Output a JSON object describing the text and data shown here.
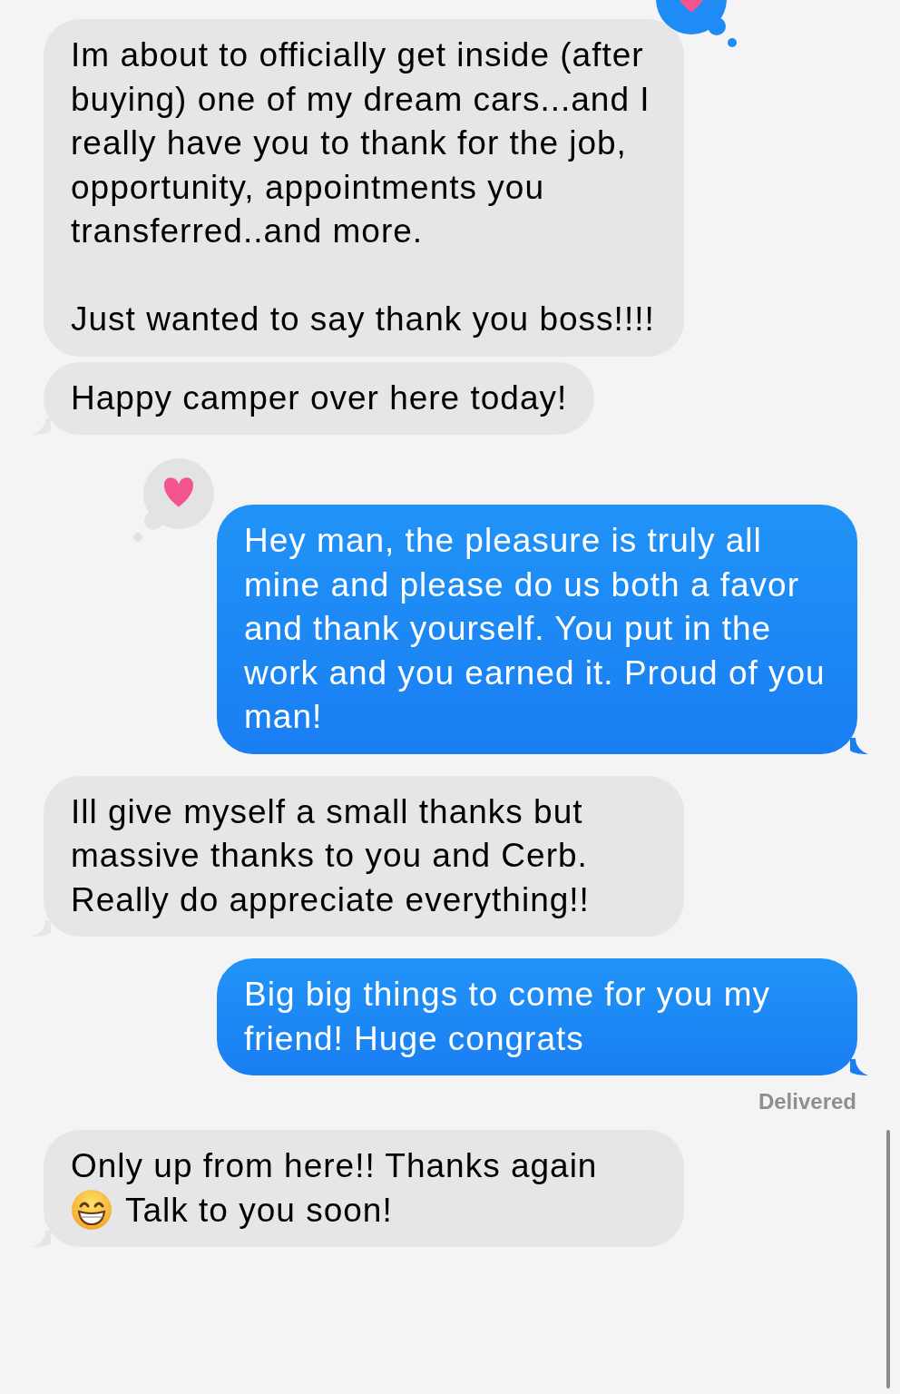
{
  "messages": [
    {
      "kind": "received",
      "parts": [
        {
          "kind": "text",
          "text": "Im about to officially get inside (after buying) one of my dream cars...and I really have you to thank for the job, opportunity, appointments you transferred..and more.\n\nJust wanted to say thank you boss!!!!"
        }
      ],
      "tail": false,
      "reaction": {
        "kind": "heart",
        "color": "#1f8bf5"
      }
    },
    {
      "kind": "received",
      "parts": [
        {
          "kind": "text",
          "text": "Happy camper over here today!"
        }
      ],
      "tail": true
    },
    {
      "kind": "sent",
      "parts": [
        {
          "kind": "text",
          "text": "Hey man, the pleasure is truly all mine and please do us both a favor and thank yourself. You put in the work and you earned it. Proud of you man!"
        }
      ],
      "tail": true,
      "reaction": {
        "kind": "heart",
        "color": "#e3e3e3"
      }
    },
    {
      "kind": "received",
      "parts": [
        {
          "kind": "text",
          "text": "Ill give myself a small thanks but massive thanks to you and Cerb. Really do appreciate everything!!"
        }
      ],
      "tail": true
    },
    {
      "kind": "sent",
      "parts": [
        {
          "kind": "text",
          "text": "Big big things to come for you my friend! Huge congrats"
        }
      ],
      "tail": true,
      "receipt": "Delivered"
    },
    {
      "kind": "received",
      "parts": [
        {
          "kind": "text",
          "text": "Only up from here!! Thanks again"
        },
        {
          "kind": "emoji"
        },
        {
          "kind": "text",
          "text": "Talk to you soon!"
        }
      ],
      "tail": true
    }
  ]
}
